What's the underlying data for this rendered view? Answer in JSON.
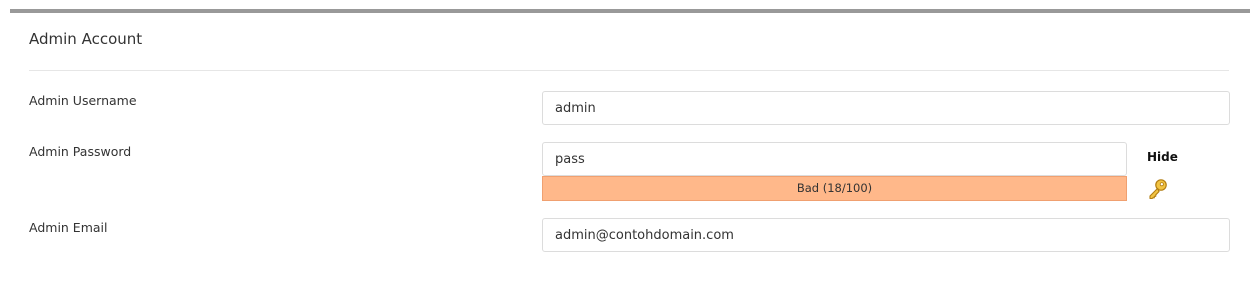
{
  "section": {
    "title": "Admin Account"
  },
  "fields": {
    "username": {
      "label": "Admin Username",
      "value": "admin"
    },
    "password": {
      "label": "Admin Password",
      "value": "pass",
      "toggle_label": "Hide",
      "strength_text": "Bad (18/100)",
      "strength_score": 18,
      "strength_color": "#ffb88a"
    },
    "email": {
      "label": "Admin Email",
      "value": "admin@contohdomain.com"
    }
  },
  "icons": {
    "generate_password": "key-icon"
  },
  "colors": {
    "top_border": "#999999",
    "key_gold": "#e0a520"
  }
}
